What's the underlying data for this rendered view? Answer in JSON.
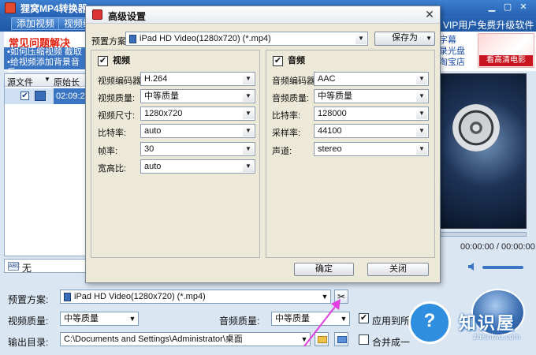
{
  "app": {
    "title": "狸窝MP4转换器",
    "vip_text": "VIP用户免费升级软件"
  },
  "toolbar": {
    "add_video": "添加视频",
    "video_edit": "视频编"
  },
  "help": {
    "title": "常见问题解决",
    "links": [
      "•如何压缩视频  截取",
      "•给视频添加背景音乐"
    ]
  },
  "file_table": {
    "headers": [
      "源文件",
      "原始长度"
    ],
    "rows": [
      {
        "checked": true,
        "duration": "02:09:24"
      }
    ]
  },
  "subtitle": {
    "value": "无"
  },
  "ad": {
    "text_lines": [
      "字幕",
      "录光盘",
      "淘宝店"
    ],
    "banner": "看高清电影"
  },
  "player": {
    "time": "00:00:00 / 00:00:00"
  },
  "bottom": {
    "preset_label": "预置方案:",
    "preset_value": "iPad HD Video(1280x720) (*.mp4)",
    "video_quality_label": "视频质量:",
    "video_quality_value": "中等质量",
    "audio_quality_label": "音频质量:",
    "audio_quality_value": "中等质量",
    "apply_all": "应用到所",
    "output_label": "输出目录:",
    "output_path": "C:\\Documents and Settings\\Administrator\\桌面",
    "merge": "合并成一"
  },
  "dialog": {
    "title": "高级设置",
    "preset_label": "预置方案:",
    "preset_value": "iPad HD Video(1280x720) (*.mp4)",
    "save_as": "保存为",
    "video": {
      "heading": "视频",
      "checked": true,
      "fields": [
        {
          "label": "视频编码器:",
          "value": "H.264"
        },
        {
          "label": "视频质量:",
          "value": "中等质量"
        },
        {
          "label": "视频尺寸:",
          "value": "1280x720"
        },
        {
          "label": "比特率:",
          "value": "auto"
        },
        {
          "label": "帧率:",
          "value": "30"
        },
        {
          "label": "宽高比:",
          "value": "auto"
        }
      ]
    },
    "audio": {
      "heading": "音频",
      "checked": true,
      "fields": [
        {
          "label": "音频编码器:",
          "value": "AAC"
        },
        {
          "label": "音频质量:",
          "value": "中等质量"
        },
        {
          "label": "比特率:",
          "value": "128000"
        },
        {
          "label": "采样率:",
          "value": "44100"
        },
        {
          "label": "声道:",
          "value": "stereo"
        }
      ]
    },
    "ok": "确定",
    "close": "关闭"
  },
  "watermark": {
    "title": "知识屋",
    "subtitle": "zhishiwu.com"
  },
  "colors": {
    "accent": "#2b67b6",
    "help_title": "#e02010",
    "arrow": "#e040e0"
  }
}
